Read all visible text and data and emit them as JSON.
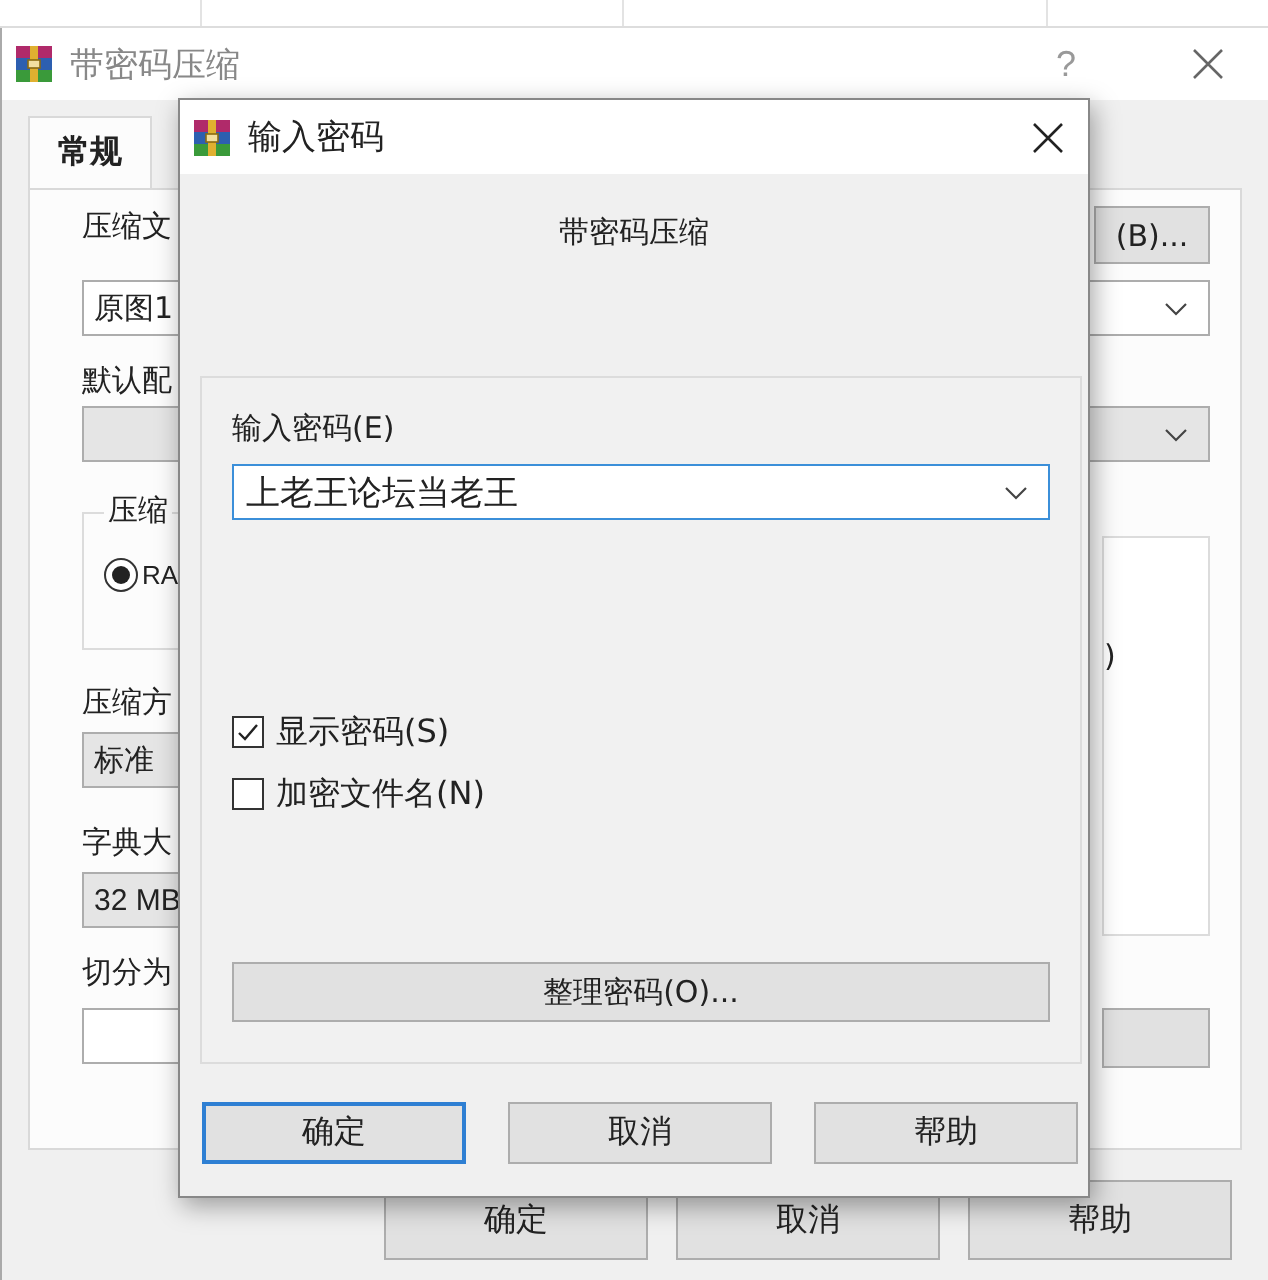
{
  "back_window": {
    "title": "带密码压缩",
    "help": "?",
    "tabs": [
      {
        "label": "常规",
        "selected": true
      }
    ],
    "archive_name": {
      "label": "压缩文",
      "value": "原图1",
      "browse_button": "(B)..."
    },
    "profile": {
      "label": "默认配"
    },
    "format_group": {
      "label": "压缩",
      "options": [
        {
          "label": "RA",
          "selected": true
        }
      ]
    },
    "options_list": {
      "item": ")"
    },
    "method": {
      "label": "压缩方",
      "value": "标准"
    },
    "dictionary": {
      "label": "字典大",
      "value": "32 MB"
    },
    "split": {
      "label": "切分为"
    },
    "buttons": [
      {
        "label": "确定"
      },
      {
        "label": "取消"
      },
      {
        "label": "帮助"
      }
    ]
  },
  "password_dialog": {
    "title": "输入密码",
    "heading": "带密码压缩",
    "password": {
      "label": "输入密码(E)",
      "value": "上老王论坛当老王"
    },
    "options": [
      {
        "label": "显示密码(S)",
        "checked": true
      },
      {
        "label": "加密文件名(N)",
        "checked": false
      }
    ],
    "organize_button": "整理密码(O)...",
    "buttons": [
      {
        "label": "确定",
        "focused": true
      },
      {
        "label": "取消",
        "focused": false
      },
      {
        "label": "帮助",
        "focused": false
      }
    ]
  }
}
